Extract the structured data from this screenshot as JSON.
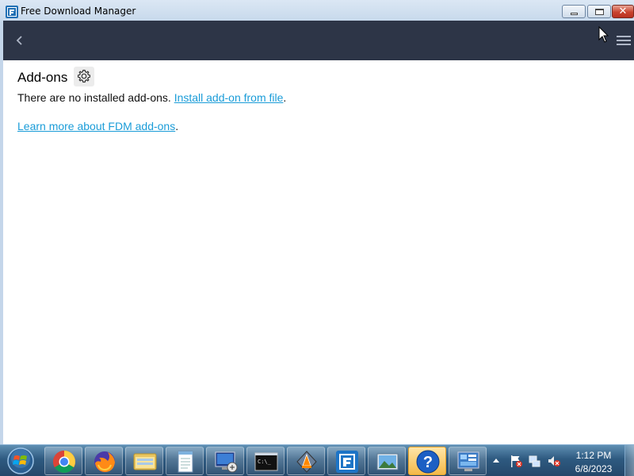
{
  "window": {
    "title": "Free Download Manager",
    "icon": "fdm-app-icon"
  },
  "toolbar": {
    "back_icon": "chevron-left-icon",
    "menu_icon": "hamburger-menu-icon",
    "background": "#2d3547"
  },
  "addons": {
    "title": "Add-ons",
    "settings_icon": "gear-icon",
    "no_addons_text": "There are no installed add-ons. ",
    "install_link": "Install add-on from file",
    "install_suffix": ".",
    "learn_link": "Learn more about FDM add-ons",
    "learn_suffix": ".",
    "link_color": "#1a9cd8"
  },
  "taskbar": {
    "pinned": [
      {
        "name": "chrome-icon"
      },
      {
        "name": "firefox-icon"
      },
      {
        "name": "file-explorer-icon"
      },
      {
        "name": "notepad-icon"
      },
      {
        "name": "remote-desktop-icon"
      },
      {
        "name": "command-prompt-icon"
      },
      {
        "name": "vlc-icon"
      },
      {
        "name": "free-download-manager-icon"
      },
      {
        "name": "photo-viewer-icon"
      },
      {
        "name": "help-icon"
      },
      {
        "name": "control-panel-icon"
      }
    ],
    "tray": [
      "flag-icon",
      "network-icon",
      "volume-muted-icon"
    ],
    "time": "1:12 PM",
    "date": "6/8/2023"
  }
}
